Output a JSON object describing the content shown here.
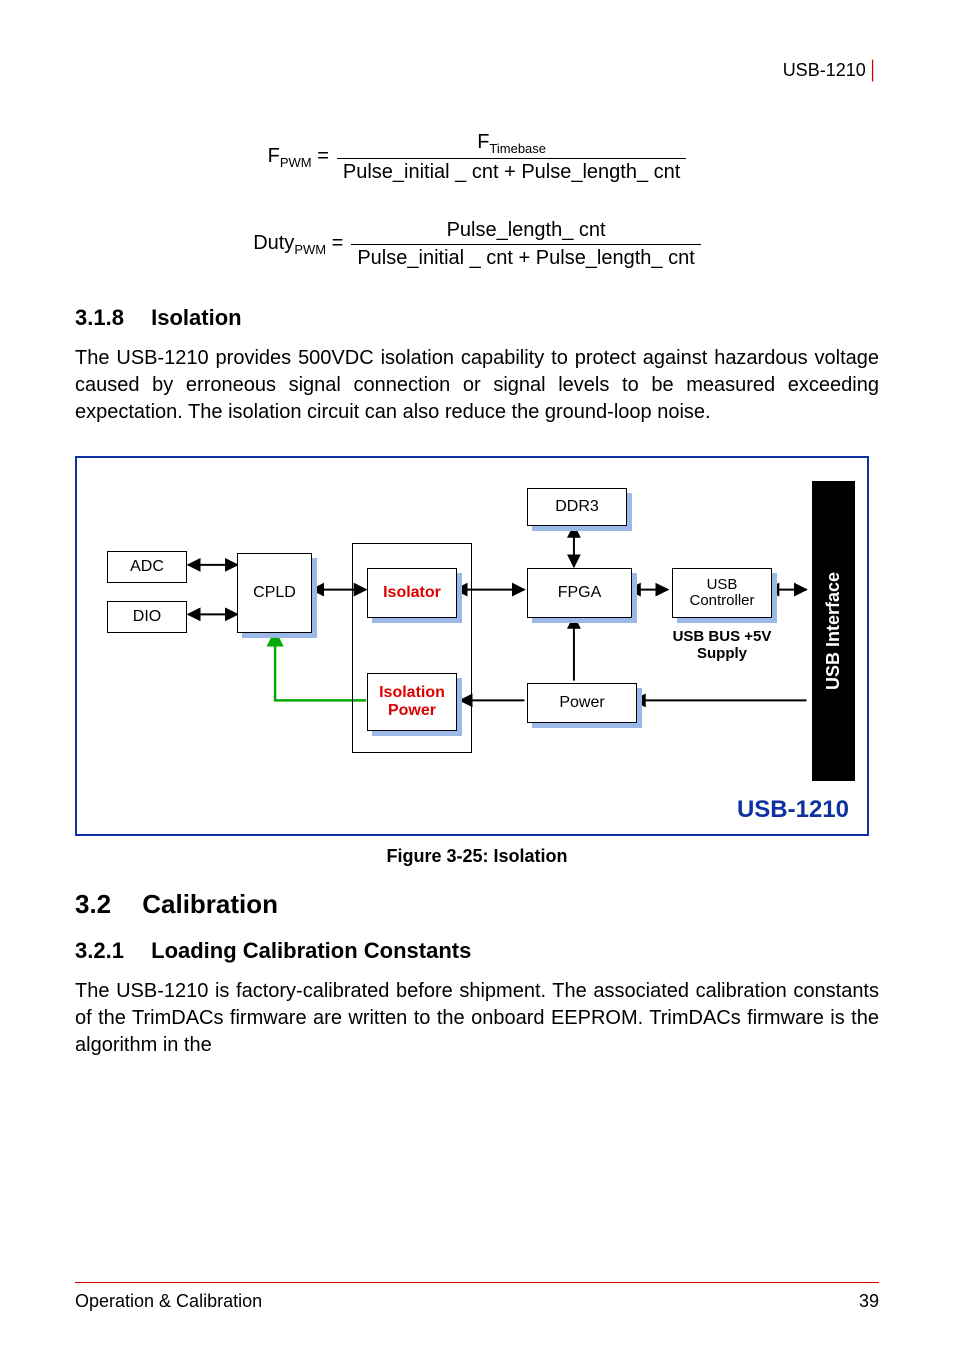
{
  "header": {
    "model": "USB-1210"
  },
  "equations": {
    "eq1": {
      "lhs_base": "F",
      "lhs_sub": "PWM",
      "num_base": "F",
      "num_sub": "Timebase",
      "den": "Pulse_initial _ cnt + Pulse_length_ cnt"
    },
    "eq2": {
      "lhs_base": "Duty",
      "lhs_sub": "PWM",
      "num": "Pulse_length_ cnt",
      "den": "Pulse_initial _ cnt + Pulse_length_ cnt"
    }
  },
  "sections": {
    "s318": {
      "num": "3.1.8",
      "title": "Isolation"
    },
    "s32": {
      "num": "3.2",
      "title": "Calibration"
    },
    "s321": {
      "num": "3.2.1",
      "title": "Loading Calibration Constants"
    }
  },
  "paragraphs": {
    "p1": "The USB-1210 provides 500VDC isolation capability to protect against hazardous voltage caused by erroneous signal connection or signal levels to be measured exceeding expectation. The isolation circuit can also reduce the ground-loop noise.",
    "p2": "The USB-1210 is factory-calibrated before shipment. The associated calibration constants of the TrimDACs firmware are written to the onboard EEPROM. TrimDACs firmware is the algorithm in the"
  },
  "figure": {
    "caption": "Figure 3-25: Isolation",
    "blocks": {
      "adc": "ADC",
      "dio": "DIO",
      "cpld": "CPLD",
      "isolator": "Isolator",
      "isopower": "Isolation Power",
      "ddr3": "DDR3",
      "fpga": "FPGA",
      "power": "Power",
      "usbctrl": "USB Controller",
      "usbif": "USB Interface",
      "supply": "USB BUS +5V Supply",
      "model": "USB-1210"
    }
  },
  "footer": {
    "left": "Operation & Calibration",
    "right": "39"
  }
}
